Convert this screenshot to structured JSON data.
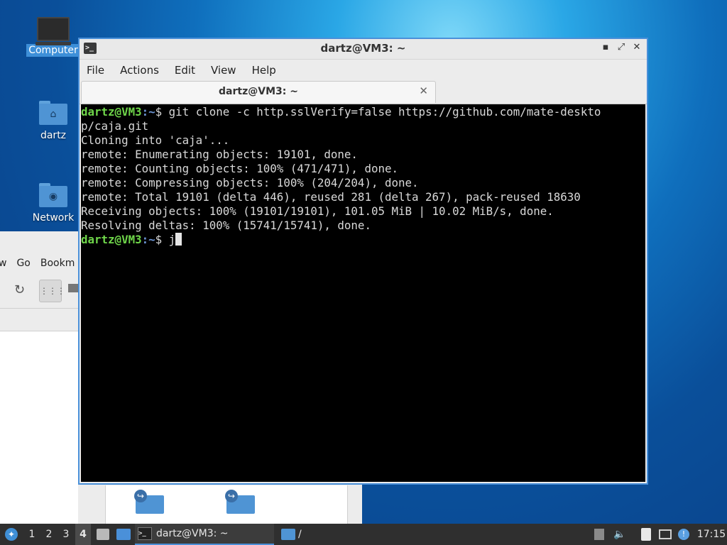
{
  "desktop": {
    "icons": [
      {
        "label": "Computer"
      },
      {
        "label": "dartz"
      },
      {
        "label": "Network"
      }
    ]
  },
  "file_manager": {
    "menu": [
      "w",
      "Go",
      "Bookm"
    ]
  },
  "terminal_window": {
    "title": "dartz@VM3: ~",
    "menu": [
      "File",
      "Actions",
      "Edit",
      "View",
      "Help"
    ],
    "tab_label": "dartz@VM3: ~",
    "prompt_user": "dartz@VM3",
    "prompt_path": ":~",
    "prompt_symbol": "$ ",
    "command_line_1": "git clone -c http.sslVerify=false https://github.com/mate-deskto",
    "command_line_2": "p/caja.git",
    "output": [
      "Cloning into 'caja'...",
      "remote: Enumerating objects: 19101, done.",
      "remote: Counting objects: 100% (471/471), done.",
      "remote: Compressing objects: 100% (204/204), done.",
      "remote: Total 19101 (delta 446), reused 281 (delta 267), pack-reused 18630",
      "Receiving objects: 100% (19101/19101), 101.05 MiB | 10.02 MiB/s, done.",
      "Resolving deltas: 100% (15741/15741), done."
    ],
    "current_input": "j"
  },
  "taskbar": {
    "workspaces": [
      "1",
      "2",
      "3",
      "4"
    ],
    "active_workspace": "4",
    "tasks": [
      {
        "label": "dartz@VM3: ~"
      },
      {
        "label": "/"
      }
    ],
    "clock": "17:15"
  },
  "colors": {
    "prompt_user": "#6fd64a",
    "prompt_path": "#6d96d6",
    "accent": "#4a90d9"
  }
}
